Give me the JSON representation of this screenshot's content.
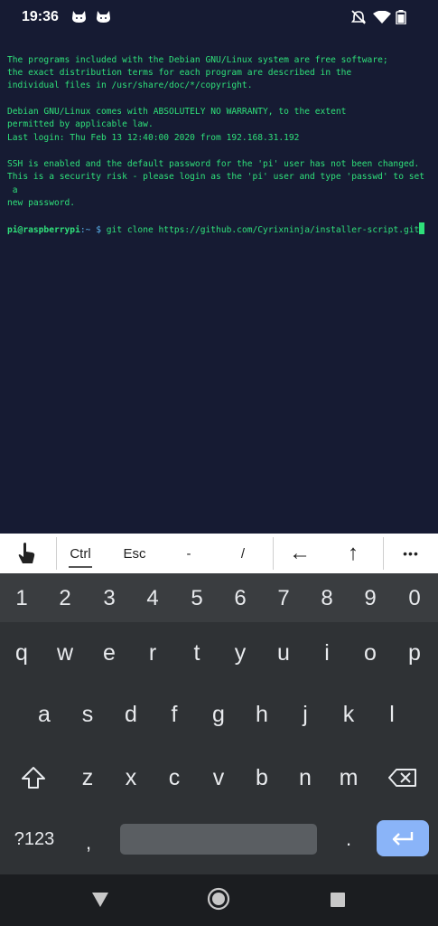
{
  "status_bar": {
    "time": "19:36",
    "icons": [
      "cat-notification-icon",
      "cat-notification-icon",
      "do-not-disturb-icon",
      "wifi-icon",
      "battery-icon"
    ]
  },
  "terminal": {
    "lines": [
      "The programs included with the Debian GNU/Linux system are free software;",
      "the exact distribution terms for each program are described in the",
      "individual files in /usr/share/doc/*/copyright.",
      "",
      "Debian GNU/Linux comes with ABSOLUTELY NO WARRANTY, to the extent",
      "permitted by applicable law.",
      "Last login: Thu Feb 13 12:40:00 2020 from 192.168.31.192",
      "",
      "SSH is enabled and the default password for the 'pi' user has not been changed.",
      "This is a security risk - please login as the 'pi' user and type 'passwd' to set",
      " a",
      "new password."
    ],
    "prompt_user": "pi@raspberrypi",
    "prompt_path": ":~ $",
    "command": "git clone https://github.com/Cyrixninja/installer-script.git"
  },
  "extra_keys": {
    "ctrl": "Ctrl",
    "esc": "Esc",
    "dash": "-",
    "slash": "/",
    "left_arrow": "←",
    "up_arrow": "↑",
    "more": "•••"
  },
  "keyboard": {
    "numbers": [
      "1",
      "2",
      "3",
      "4",
      "5",
      "6",
      "7",
      "8",
      "9",
      "0"
    ],
    "row1": [
      "q",
      "w",
      "e",
      "r",
      "t",
      "y",
      "u",
      "i",
      "o",
      "p"
    ],
    "row2": [
      "a",
      "s",
      "d",
      "f",
      "g",
      "h",
      "j",
      "k",
      "l"
    ],
    "row3": [
      "z",
      "x",
      "c",
      "v",
      "b",
      "n",
      "m"
    ],
    "symbols_key": "?123",
    "comma_key": ",",
    "period_key": "."
  },
  "colors": {
    "terminal_bg": "#161b33",
    "terminal_text": "#2fe07a",
    "keyboard_bg": "#2f3235",
    "enter_key": "#8ab4f8"
  }
}
